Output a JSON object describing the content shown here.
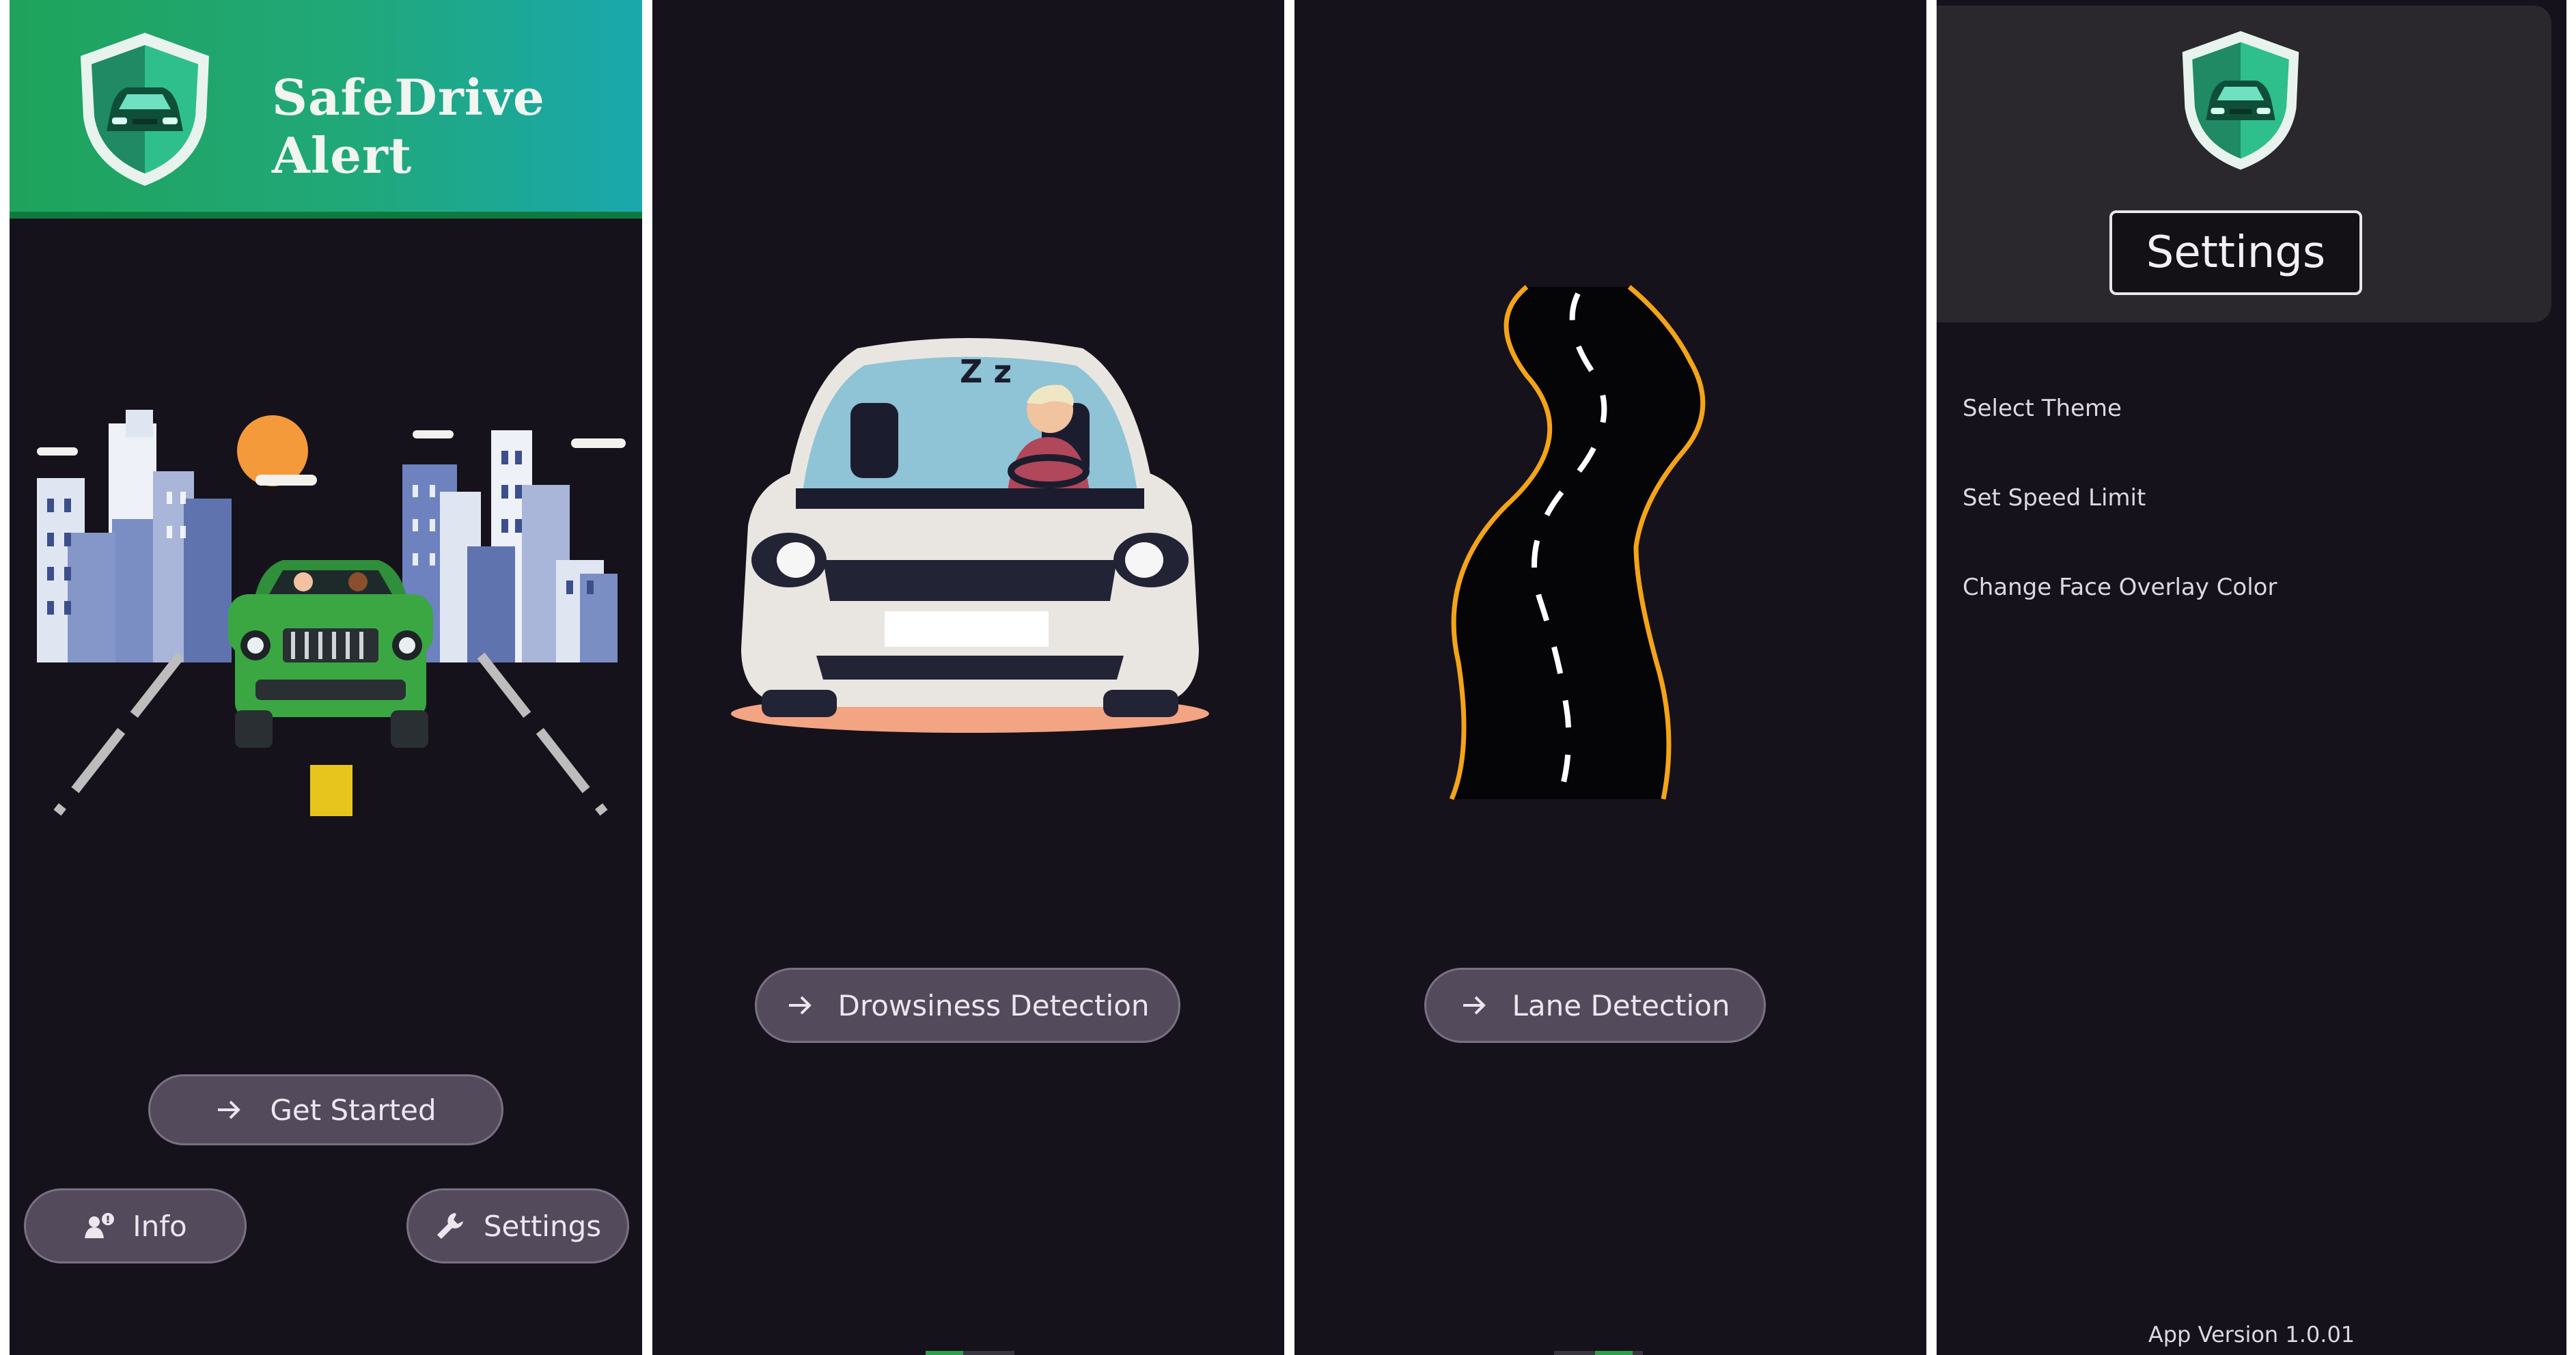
{
  "home": {
    "app_title": "SafeDrive Alert",
    "get_started_label": "Get Started",
    "info_label": "Info",
    "settings_label": "Settings"
  },
  "drowsiness": {
    "button_label": "Drowsiness Detection",
    "sleep_text": "Z z"
  },
  "lane": {
    "button_label": "Lane Detection"
  },
  "settings": {
    "title": "Settings",
    "items": [
      "Select Theme",
      "Set Speed Limit",
      "Change Face Overlay Color"
    ],
    "version": "App Version 1.0.01"
  },
  "colors": {
    "header_gradient_start": "#1fa35b",
    "header_gradient_end": "#1aa8ad",
    "background": "#16121b",
    "button_fill": "#534a5c",
    "lane_edge": "#f4a418",
    "car_green": "#3aa743"
  },
  "icons": [
    "shield-car-logo-icon",
    "arrow-right-icon",
    "info-person-icon",
    "wrench-icon"
  ]
}
